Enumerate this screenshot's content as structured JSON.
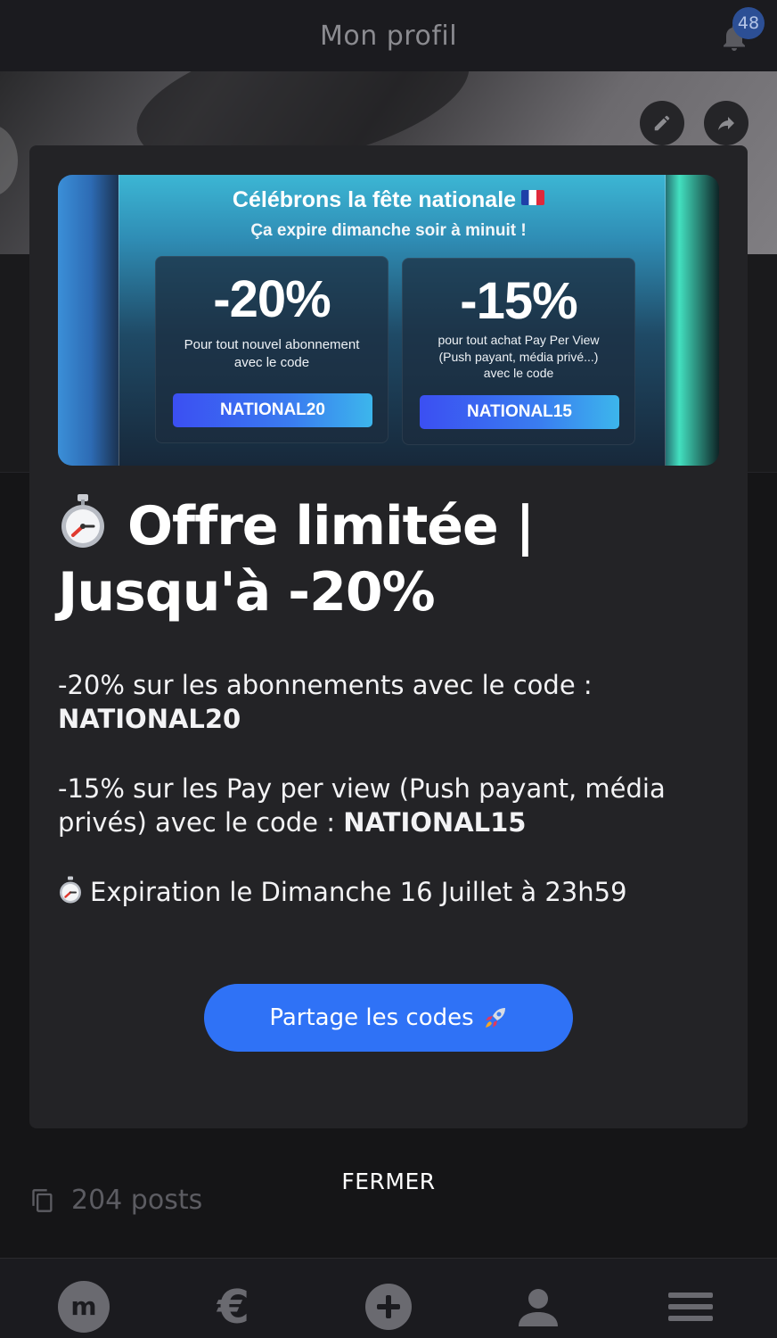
{
  "header": {
    "title": "Mon profil",
    "notification_count": "48"
  },
  "profile": {
    "posts_label": "204 posts"
  },
  "modal": {
    "banner": {
      "title": "Célébrons la fête nationale",
      "subtitle": "Ça expire dimanche soir à minuit !",
      "offers": [
        {
          "percent": "-20%",
          "desc": [
            "Pour tout nouvel abonnement",
            "avec le code"
          ],
          "code": "NATIONAL20"
        },
        {
          "percent": "-15%",
          "desc": [
            "pour tout achat Pay Per View",
            "(Push payant, média privé...)",
            "avec le code"
          ],
          "code": "NATIONAL15"
        }
      ]
    },
    "heading": "Offre limitée | Jusqu'à -20%",
    "para1_text": "-20% sur les abonnements avec le code :",
    "para1_code": "NATIONAL20",
    "para2_text": "-15% sur les Pay per view (Push payant, média privés) avec le code :",
    "para2_code": "NATIONAL15",
    "expiration": "Expiration le Dimanche 16 Juillet à 23h59",
    "share_button": "Partage les codes",
    "close_button": "FERMER"
  },
  "nav": {
    "logo_letter": "m",
    "items": [
      "home-logo",
      "euro-icon",
      "add-circle-icon",
      "profile-icon",
      "menu-icon"
    ]
  },
  "colors": {
    "accent_blue": "#2f72f6",
    "modal_bg": "#232326",
    "page_bg": "#151517"
  }
}
